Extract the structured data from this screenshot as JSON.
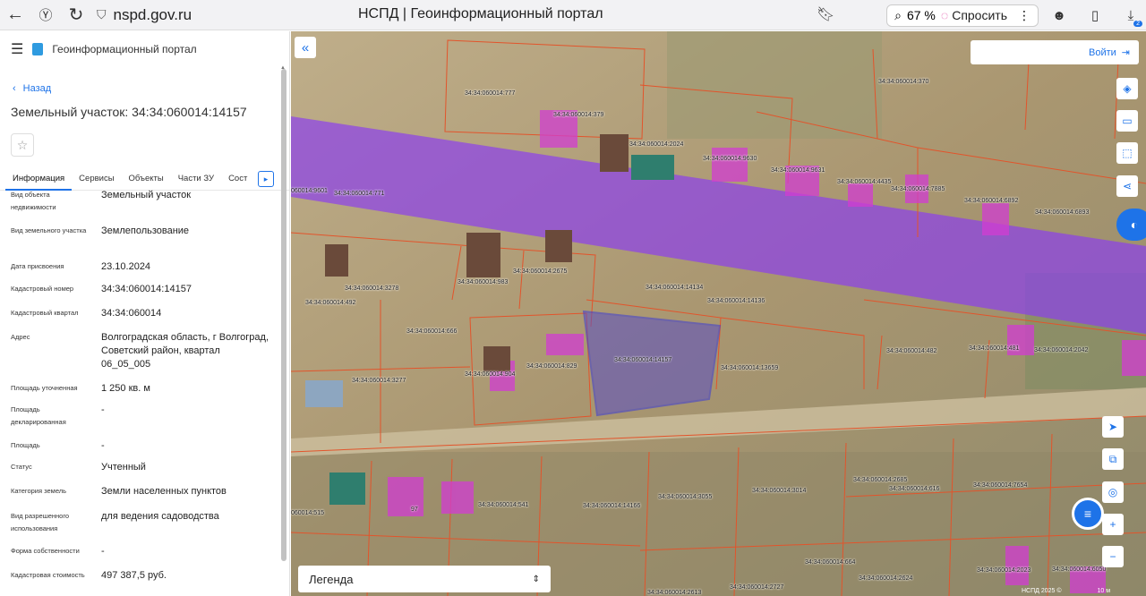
{
  "browser": {
    "url": "nspd.gov.ru",
    "title": "НСПД | Геоинформационный портал",
    "zoom": "67 %",
    "ask_label": "Спросить",
    "downloads_badge": "2"
  },
  "sidebar": {
    "portal_name": "Геоинформационный портал",
    "back_label": "Назад",
    "title": "Земельный участок: 34:34:060014:14157",
    "tabs": [
      "Информация",
      "Сервисы",
      "Объекты",
      "Части ЗУ",
      "Сост"
    ],
    "properties": [
      {
        "key": "Вид объекта недвижимости",
        "value": "Земельный участок"
      },
      {
        "key": "Вид земельного участка",
        "value": "Землепользование"
      },
      {
        "key": "Дата присвоения",
        "value": "23.10.2024"
      },
      {
        "key": "Кадастровый номер",
        "value": "34:34:060014:14157"
      },
      {
        "key": "Кадастровый квартал",
        "value": "34:34:060014"
      },
      {
        "key": "Адрес",
        "value": "Волгоградская область, г Волгоград, Советский район, квартал 06_05_005"
      },
      {
        "key": "Площадь уточненная",
        "value": "1 250 кв. м"
      },
      {
        "key": "Площадь декларированная",
        "value": "-"
      },
      {
        "key": "Площадь",
        "value": "-"
      },
      {
        "key": "Статус",
        "value": "Учтенный"
      },
      {
        "key": "Категория земель",
        "value": "Земли населенных пунктов"
      },
      {
        "key": "Вид разрешенного использования",
        "value": "для ведения садоводства"
      },
      {
        "key": "Форма собственности",
        "value": "-"
      },
      {
        "key": "Кадастровая стоимость",
        "value": "497 387,5 руб."
      }
    ]
  },
  "map": {
    "login_label": "Войти",
    "legend_label": "Легенда",
    "copyright": "НСПД 2025 ©",
    "scale": "10 м",
    "parcel_labels": [
      "34:34:060014:777",
      "34:34:060014:379",
      "34:34:060014:2024",
      "34:34:060014:370",
      "34:34:060014:9630",
      "34:34:060014:9631",
      "34:34:060014:4435",
      "34:34:060014:7885",
      "34:34:060014:6892",
      "34:34:060014:6893",
      "060014:9601",
      "34:34:060014:771",
      "34:34:060014:2675",
      "34:34:060014:983",
      "34:34:060014:3278",
      "34:34:060014:492",
      "34:34:060014:14134",
      "34:34:060014:14136",
      "34:34:060014:666",
      "34:34:060014:829",
      "34:34:060014:904",
      "34:34:060014:14157",
      "34:34:060014:13659",
      "34:34:060014:3277",
      "34:34:060014:482",
      "34:34:060014:481",
      "34:34:060014:2042",
      "34:34:060014:2685",
      "34:34:060014:616",
      "34:34:060014:7654",
      "34:34:060014:3014",
      "060014:515",
      "97",
      "34:34:060014:541",
      "34:34:060014:14166",
      "34:34:060014:3055",
      "34:34:060014:664",
      "34:34:060014:2023",
      "34:34:060014:6050",
      "34:34:060014:2624",
      "34:34:060014:2613",
      "34:34:060014:2727"
    ]
  },
  "colors": {
    "accent": "#1e73e8",
    "zone": "#8a3cf0",
    "building": "#d23cd2",
    "boundary": "#e2542b",
    "selected": "#3a3ad8"
  }
}
